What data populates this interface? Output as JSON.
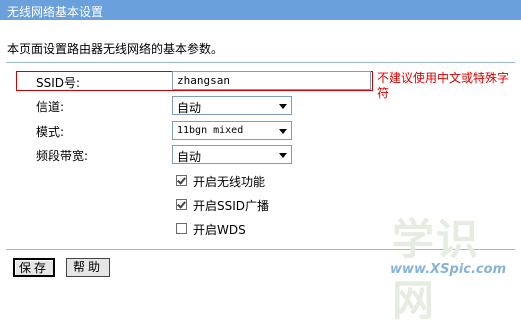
{
  "window": {
    "title": "无线网络基本设置"
  },
  "intro": "本页面设置路由器无线网络的基本参数。",
  "form": {
    "ssid": {
      "label": "SSID号:",
      "value": "zhangsan",
      "note": "不建议使用中文或特殊字符"
    },
    "channel": {
      "label": "信道:",
      "value": "自动"
    },
    "mode": {
      "label": "模式:",
      "value": "11bgn mixed"
    },
    "bandwidth": {
      "label": "频段带宽:",
      "value": "自动"
    },
    "checkboxes": [
      {
        "label": "开启无线功能",
        "checked": true
      },
      {
        "label": "开启SSID广播",
        "checked": true
      },
      {
        "label": "开启WDS",
        "checked": false
      }
    ]
  },
  "buttons": {
    "save": "保存",
    "help": "帮助"
  },
  "watermark": {
    "text": "学识网",
    "url": "www.XSpic.com"
  },
  "colors": {
    "title_bar": "#6aa0dc",
    "note": "#e00000",
    "highlight_border": "#d00000"
  }
}
